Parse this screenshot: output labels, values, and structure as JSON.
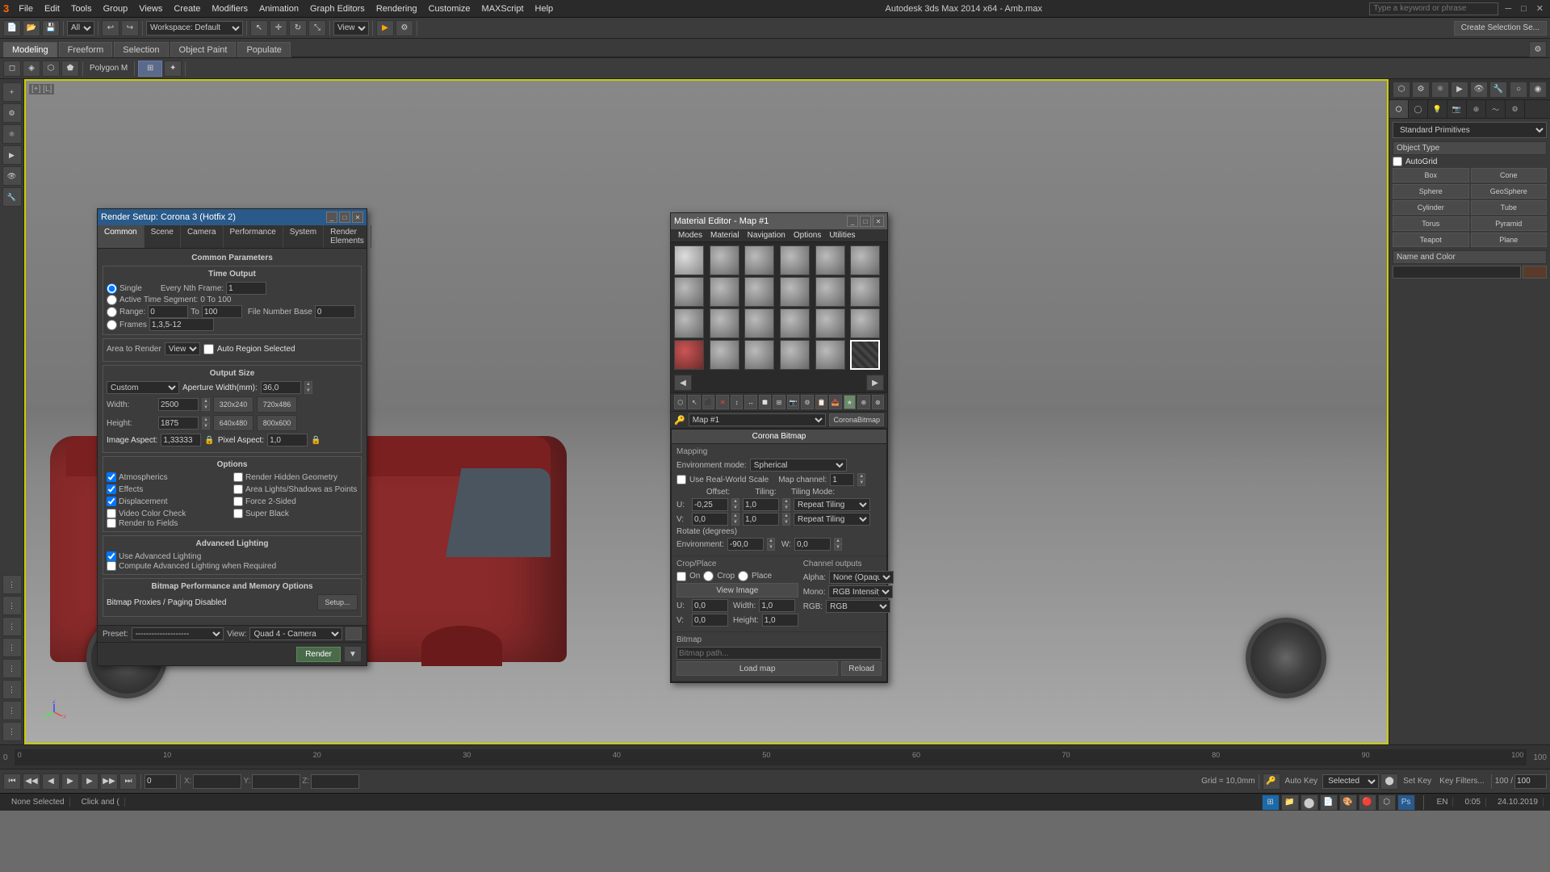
{
  "app": {
    "title": "Autodesk 3ds Max 2014 x64 - Amb.max",
    "search_placeholder": "Type a keyword or phrase"
  },
  "topmenu": {
    "items": [
      "File",
      "Edit",
      "Tools",
      "Group",
      "Views",
      "Create",
      "Modifiers",
      "Animation",
      "Graph Editors",
      "Rendering",
      "Customize",
      "MAXScript",
      "Help"
    ]
  },
  "workspace_label": "Workspace: Default",
  "tabs": {
    "items": [
      "Modeling",
      "Freeform",
      "Selection",
      "Object Paint",
      "Populate"
    ]
  },
  "render_dialog": {
    "title": "Render Setup: Corona 3 (Hotfix 2)",
    "tabs": [
      "Common",
      "Scene",
      "Camera",
      "Performance",
      "System",
      "Render Elements"
    ],
    "active_tab": "Common",
    "section_title": "Common Parameters",
    "time_output": {
      "label": "Time Output",
      "options": [
        "Single",
        "Active Time Segment",
        "Range",
        "Frames"
      ],
      "every_nth_label": "Every Nth Frame:",
      "every_nth_value": "1",
      "active_time": "0 To 100",
      "range_from": "0",
      "range_to": "100",
      "file_number_base": "0",
      "frames_value": "1,3,5-12"
    },
    "area_to_render": {
      "label": "Area to Render",
      "value": "View",
      "auto_region": "Auto Region Selected"
    },
    "output_size": {
      "label": "Output Size",
      "preset": "Custom",
      "aperture_label": "Aperture Width(mm):",
      "aperture_value": "36,0",
      "width_label": "Width:",
      "width_value": "2500",
      "height_label": "Height:",
      "height_value": "1875",
      "presets": [
        "320x240",
        "720x486",
        "640x480",
        "800x600"
      ],
      "image_aspect_label": "Image Aspect:",
      "image_aspect_value": "1,33333",
      "pixel_aspect_label": "Pixel Aspect:",
      "pixel_aspect_value": "1,0"
    },
    "options": {
      "label": "Options",
      "checkboxes": [
        {
          "label": "Atmospherics",
          "checked": true
        },
        {
          "label": "Render Hidden Geometry",
          "checked": false
        },
        {
          "label": "Effects",
          "checked": true
        },
        {
          "label": "Area Lights/Shadows as Points",
          "checked": false
        },
        {
          "label": "Displacement",
          "checked": true
        },
        {
          "label": "Force 2-Sided",
          "checked": false
        },
        {
          "label": "Video Color Check",
          "checked": false
        },
        {
          "label": "Super Black",
          "checked": false
        },
        {
          "label": "Render to Fields",
          "checked": false
        }
      ]
    },
    "advanced_lighting": {
      "label": "Advanced Lighting",
      "checkboxes": [
        {
          "label": "Use Advanced Lighting",
          "checked": true
        },
        {
          "label": "Compute Advanced Lighting when Required",
          "checked": false
        }
      ]
    },
    "bitmap_performance": {
      "label": "Bitmap Performance and Memory Options",
      "status": "Bitmap Proxies / Paging Disabled",
      "setup_btn": "Setup..."
    },
    "preset_label": "Preset:",
    "preset_value": "--------------------",
    "view_label": "View:",
    "view_value": "Quad 4 - Camera",
    "render_btn": "Render"
  },
  "material_editor": {
    "title": "Material Editor - Map #1",
    "menu_items": [
      "Modes",
      "Material",
      "Navigation",
      "Options",
      "Utilities"
    ],
    "slot_count": 24,
    "map_path_label": "Map #1",
    "map_type": "CoronaBitmap"
  },
  "corona_bitmap": {
    "title": "Corona Bitmap",
    "mapping_label": "Mapping",
    "environment_mode_label": "Environment mode:",
    "environment_mode_value": "Spherical",
    "use_real_world": "Use Real-World Scale",
    "map_channel_label": "Map channel:",
    "map_channel_value": "1",
    "offset_label": "Offset:",
    "tiling_label": "Tiling:",
    "tiling_mode_label": "Tiling Mode:",
    "u_offset": "-0,25",
    "v_offset": "0,0",
    "u_tiling": "1,0",
    "v_tiling": "1,0",
    "u_tiling_mode": "Repeat Tiling",
    "v_tiling_mode": "Repeat Tiling",
    "rotate_label": "Rotate (degrees)",
    "environment_rotate_label": "Environment:",
    "environment_rotate_value": "-90,0",
    "w_label": "W:",
    "w_value": "0,0",
    "crop_place_label": "Crop/Place",
    "on_label": "On",
    "crop_label": "Crop",
    "place_label": "Place",
    "view_image_label": "View Image",
    "u_crop": "0,0",
    "v_crop": "0,0",
    "width_crop": "1,0",
    "height_crop": "1,0",
    "channel_outputs_label": "Channel outputs",
    "alpha_label": "Alpha:",
    "alpha_value": "None (Opaque)",
    "mono_label": "Mono:",
    "mono_value": "RGB Intensity",
    "rgb_label": "RGB:",
    "rgb_value": "RGB",
    "bitmap_label": "Bitmap",
    "load_map_btn": "Load map",
    "reload_btn": "Reload"
  },
  "right_panel": {
    "dropdown": "Standard Primitives",
    "object_type_label": "Object Type",
    "autogrid": "AutoGrid",
    "buttons": [
      "Box",
      "Cone",
      "Sphere",
      "GeoSphere",
      "Cylinder",
      "Tube",
      "Torus",
      "Pyramid",
      "Teapot",
      "Plane"
    ],
    "name_color_label": "Name and Color"
  },
  "viewport": {
    "label": "[+] [L]",
    "axes_label": "XYZ"
  },
  "status_bar": {
    "none_selected": "None Selected",
    "click_drag": "Click and (",
    "selected": "Selected",
    "coords": {
      "x": "",
      "y": "",
      "z": ""
    },
    "grid": "Grid = 10,0mm",
    "auto_key": "Auto Key",
    "key_filters": "Key Filters...",
    "time_value": "100",
    "anim_mode": "Selected",
    "time_display": "100 / 100",
    "date": "24.10.2019",
    "time": "0:05",
    "lang": "EN"
  },
  "taskbar": {
    "apps": [
      "Windows",
      "File Explorer",
      "Chrome",
      "app3",
      "app4",
      "app5",
      "app6",
      "Photoshop"
    ]
  }
}
